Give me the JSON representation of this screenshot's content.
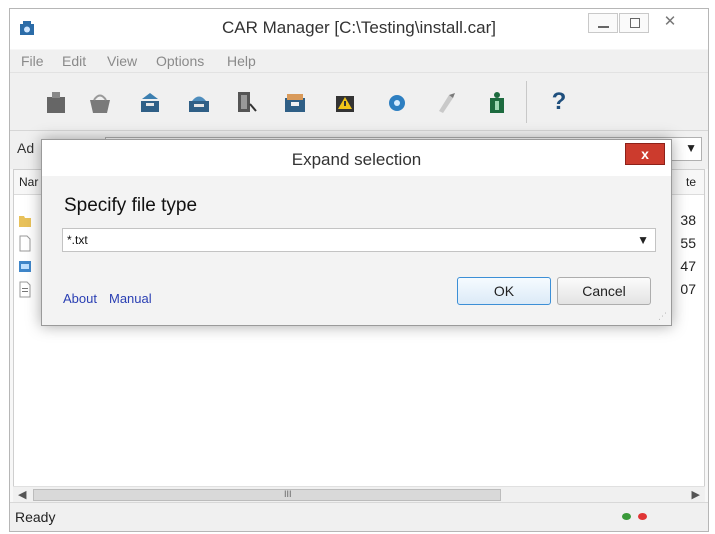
{
  "window": {
    "title": "CAR Manager [C:\\Testing\\install.car]",
    "close_glyph": "✕"
  },
  "menu": [
    "File",
    "Edit",
    "View",
    "Options",
    "Help"
  ],
  "toolbar": {
    "icons": [
      "bag-icon",
      "basket-icon",
      "extract-icon",
      "pack-icon",
      "filter-icon",
      "box-icon",
      "warning-icon",
      "disk-icon",
      "brush-icon",
      "info-icon"
    ],
    "help_glyph": "?"
  },
  "address": {
    "label": "Ad",
    "arrow": "▼"
  },
  "list": {
    "col_name": "Nar",
    "col_date": "te",
    "rows": [
      {
        "icon": "folder-icon",
        "date": "38"
      },
      {
        "icon": "file-icon",
        "date": "55"
      },
      {
        "icon": "image-file-icon",
        "date": "47"
      },
      {
        "icon": "text-file-icon",
        "date": "07"
      }
    ]
  },
  "scroll": {
    "left": "◀",
    "right": "▶",
    "grip": "III"
  },
  "status": {
    "text": "Ready",
    "led_green": "#3a9a3a",
    "led_red": "#e03535"
  },
  "dialog": {
    "title": "Expand selection",
    "close_glyph": "x",
    "heading": "Specify file type",
    "combo_value": "*.txt",
    "combo_arrow": "▼",
    "about": "About",
    "manual": "Manual",
    "ok": "OK",
    "cancel": "Cancel"
  }
}
